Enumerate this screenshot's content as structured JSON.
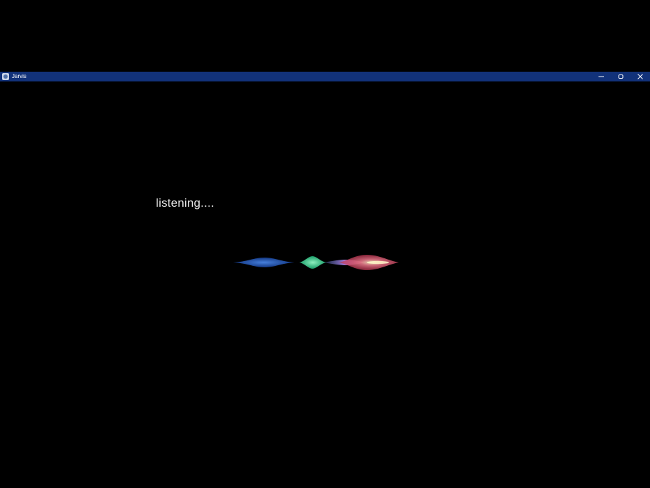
{
  "window": {
    "title": "Jarvis",
    "titlebar_color": "#12327a",
    "background_color": "#000000"
  },
  "controls": {
    "minimize_icon": "minimize-icon",
    "restore_icon": "restore-icon",
    "close_icon": "close-icon"
  },
  "assistant": {
    "status": "listening....",
    "waveform_colors": {
      "blue": "#2e6fe0",
      "green": "#3fd28f",
      "purple": "#a477e8",
      "red": "#e0435d",
      "highlight": "#fff6c8"
    }
  }
}
